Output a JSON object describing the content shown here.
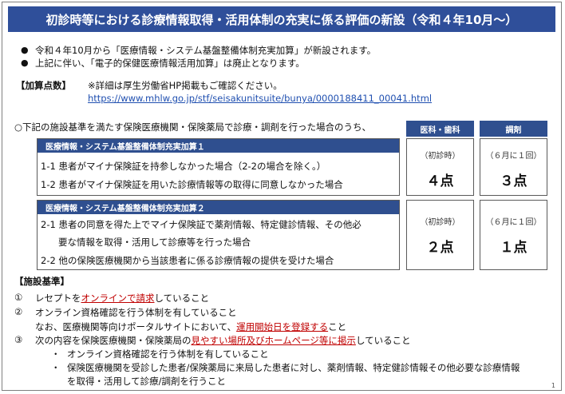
{
  "title": "初診時等における診療情報取得・活用体制の充実に係る評価の新設（令和４年10月～）",
  "intro_bullets": [
    "令和４年10月から「医療情報・システム基盤整備体制充実加算」が新設されます。",
    "上記に伴い、「電子的保健医療情報活用加算」は廃止となります。"
  ],
  "points": {
    "label": "【加算点数】",
    "note": "※詳細は厚生労働省HP掲載もご確認ください。",
    "url": "https://www.mhlw.go.jp/stf/seisakunitsuite/bunya/0000188411_00041.html"
  },
  "condition_line": "○下記の施設基準を満たす保険医療機関・保険薬局で診療・調剤を行った場合のうち、",
  "columns": [
    "医科・歯科",
    "調剤"
  ],
  "groups": [
    {
      "header": "医療情報・システム基盤整備体制充実加算１",
      "lines": [
        "1-1 患者がマイナ保険証を持参しなかった場合（2-2の場合を除く。）",
        "1-2 患者がマイナ保険証を用いた診療情報等の取得に同意しなかった場合"
      ],
      "medical": {
        "label": "（初診時）",
        "value": "４点"
      },
      "pharmacy": {
        "label": "（６月に１回）",
        "value": "３点"
      }
    },
    {
      "header": "医療情報・システム基盤整備体制充実加算２",
      "lines": [
        "2-1 患者の同意を得た上でマイナ保険証で薬剤情報、特定健診情報、その他必",
        "要な情報を取得・活用して診療等を行った場合",
        "2-2 他の保険医療機関から当該患者に係る診療情報の提供を受けた場合"
      ],
      "medical": {
        "label": "（初診時）",
        "value": "２点"
      },
      "pharmacy": {
        "label": "（６月に１回）",
        "value": "１点"
      }
    }
  ],
  "standards": {
    "label": "【施設基準】",
    "item1": {
      "num": "①",
      "pre": "レセプトを",
      "red": "オンラインで請求",
      "post": "していること"
    },
    "item2": {
      "num": "②",
      "text": "オンライン資格確認を行う体制を有していること",
      "sub_pre": "なお、医療機関等向けポータルサイトにおいて、",
      "sub_red": "運用開始日を登録する",
      "sub_post": "こと"
    },
    "item3": {
      "num": "③",
      "pre": "次の内容を保険医療機関・保険薬局の",
      "red": "見やすい場所及びホームページ等に掲示",
      "post": "していること",
      "bullets": [
        "オンライン資格確認を行う体制を有していること",
        "保険医療機関を受診した患者/保険薬局に来局した患者に対し、薬剤情報、特定健診情報その他必要な診療情報",
        "を取得・活用して診療/調剤を行うこと"
      ]
    }
  },
  "page_number": "1"
}
